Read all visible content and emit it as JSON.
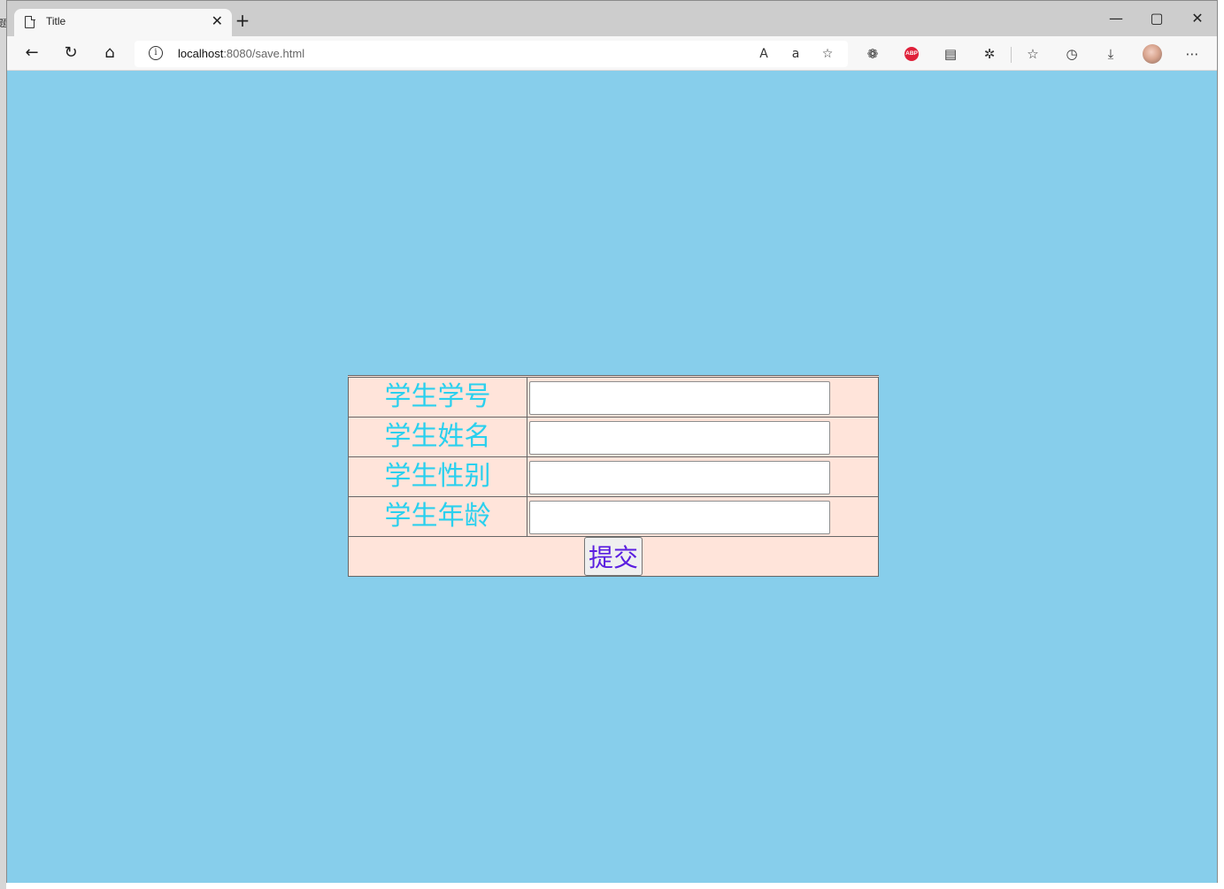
{
  "browser": {
    "tab_title": "Title",
    "url_host": "localhost",
    "url_rest": ":8080/save.html",
    "left_strip_char": "题"
  },
  "form": {
    "rows": [
      {
        "label": "学生学号",
        "value": ""
      },
      {
        "label": "学生姓名",
        "value": ""
      },
      {
        "label": "学生性别",
        "value": ""
      },
      {
        "label": "学生年龄",
        "value": ""
      }
    ],
    "submit_label": "提交"
  },
  "colors": {
    "page_background": "#87ceeb",
    "form_background": "#ffe4da",
    "label_color": "#2ad0ee",
    "submit_text": "#5a1ee0"
  }
}
